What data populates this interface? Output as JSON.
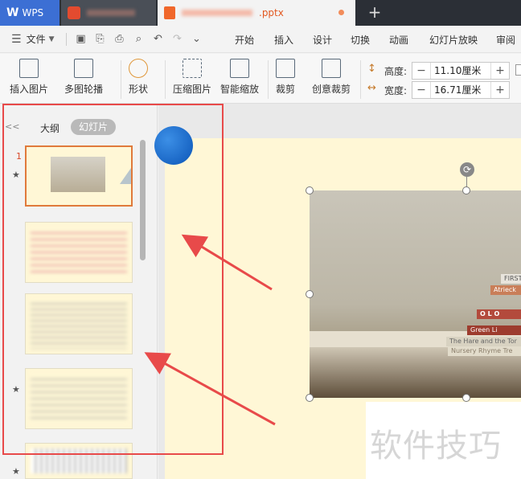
{
  "titlebar": {
    "app_tab": "WPS",
    "doc_ext": ".pptx",
    "new_tab": "+"
  },
  "menubar": {
    "file": "文件",
    "items": [
      "开始",
      "插入",
      "设计",
      "切换",
      "动画",
      "幻灯片放映",
      "审阅"
    ]
  },
  "toolbar": {
    "insert_picture": "插入图片",
    "multi_carousel": "多图轮播",
    "shape": "形状",
    "compress_picture": "压缩图片",
    "smart_zoom": "智能缩放",
    "crop": "裁剪",
    "creative_crop": "创意裁剪",
    "height_label": "高度:",
    "height_value": "11.10厘米",
    "width_label": "宽度:",
    "width_value": "16.71厘米",
    "minus": "−",
    "plus": "+"
  },
  "panel": {
    "collapse": "<<",
    "tab_outline": "大纲",
    "tab_slides": "幻灯片",
    "slide1_number": "1",
    "star": "★"
  },
  "canvas": {
    "watermark": "软件技巧",
    "books": [
      "FIRST",
      "Atrieck",
      "O L O",
      "Green Li",
      "The Hare and the Tor",
      "Nursery Rhyme Tre"
    ]
  },
  "colors": {
    "wps_blue": "#3c6fd4",
    "annotation_red": "#e84a4a",
    "slide_bg": "#fff7d6",
    "selection_orange": "#e07a3b"
  }
}
